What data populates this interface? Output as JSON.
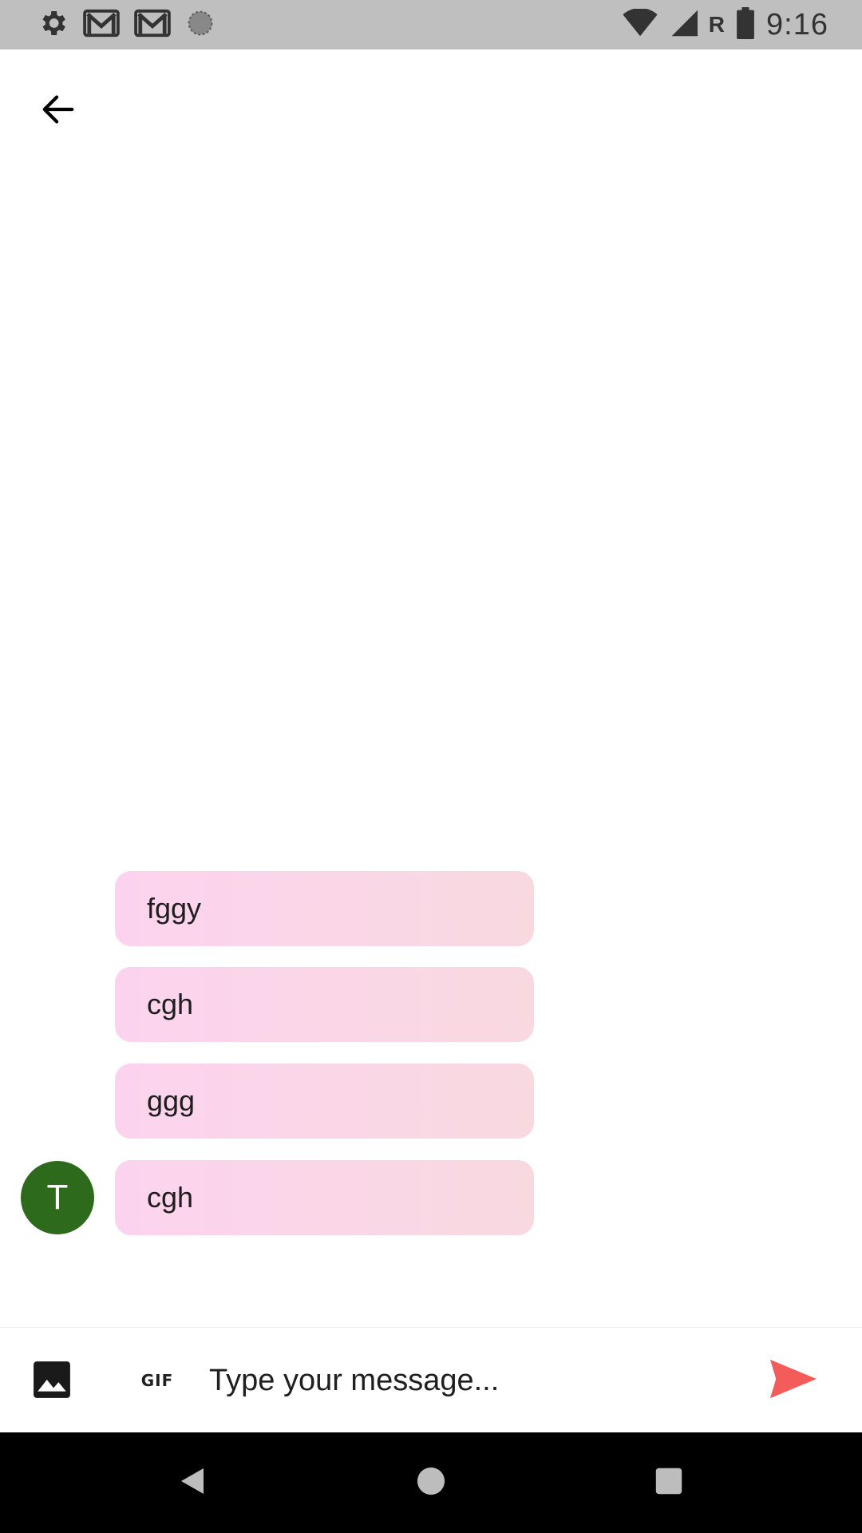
{
  "status_bar": {
    "time": "9:16",
    "network_label": "R",
    "icons_left": [
      "settings-icon",
      "gmail-icon",
      "gmail-icon",
      "sync-icon"
    ],
    "icons_right": [
      "wifi-icon",
      "signal-icon",
      "battery-icon"
    ]
  },
  "header": {
    "back_icon": "arrow-back-icon"
  },
  "messages": [
    {
      "text": "fggy"
    },
    {
      "text": "cgh"
    },
    {
      "text": "ggg"
    },
    {
      "text": "cgh",
      "avatar_letter": "T"
    }
  ],
  "composer": {
    "placeholder": "Type your message...",
    "gif_label": "GIF",
    "send_color": "#f45b5b"
  },
  "nav_bar": {
    "icons": [
      "back-triangle-icon",
      "home-circle-icon",
      "recents-square-icon"
    ]
  },
  "colors": {
    "status_bar": "#bfbfbf",
    "bubble_start": "#fcd3ee",
    "bubble_end": "#f9d9e0",
    "avatar": "#2d6a1c",
    "nav_bar": "#000000"
  }
}
